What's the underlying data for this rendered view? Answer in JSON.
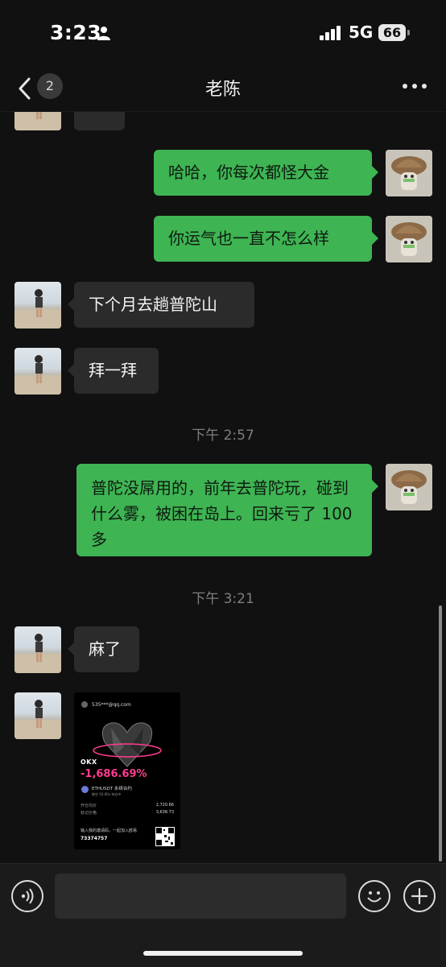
{
  "status_bar": {
    "time": "3:23",
    "network": "5G",
    "battery": "66"
  },
  "nav": {
    "unread_count": "2",
    "title": "老陈"
  },
  "messages": [
    {
      "side": "out",
      "text": "哈哈，你每次都怪大金"
    },
    {
      "side": "out",
      "text": "你运气也一直不怎么样"
    },
    {
      "side": "in",
      "text": "下个月去趟普陀山"
    },
    {
      "side": "in",
      "text": "拜一拜"
    },
    {
      "type": "time",
      "text": "下午 2:57"
    },
    {
      "side": "out",
      "text": "普陀没屌用的，前年去普陀玩，碰到什么雾，被困在岛上。回来亏了 100 多"
    },
    {
      "type": "time",
      "text": "下午 3:21"
    },
    {
      "side": "in",
      "text": "麻了"
    }
  ],
  "shared_image": {
    "account": "535***@qq.com",
    "brand": "OKX",
    "pnl": "-1,686.69%",
    "pair": "ETHUSDT 永续合约",
    "tags": "做空  50.00x  持仓中",
    "open_price_label": "开仓均价",
    "open_price": "2,720.86",
    "mark_price_label": "标记价格",
    "mark_price": "3,638.73",
    "invite_text": "输入我的邀请码，一起加入欧易",
    "invite_code": "73374757"
  },
  "input_bar": {
    "value": ""
  },
  "colors": {
    "bubble_out": "#3eb453",
    "bubble_in": "#2b2b2b",
    "background": "#111111"
  },
  "icons": [
    "person-icon",
    "signal-icon",
    "battery-icon",
    "back-chevron-icon",
    "more-icon",
    "voice-icon",
    "emoji-icon",
    "plus-icon"
  ]
}
